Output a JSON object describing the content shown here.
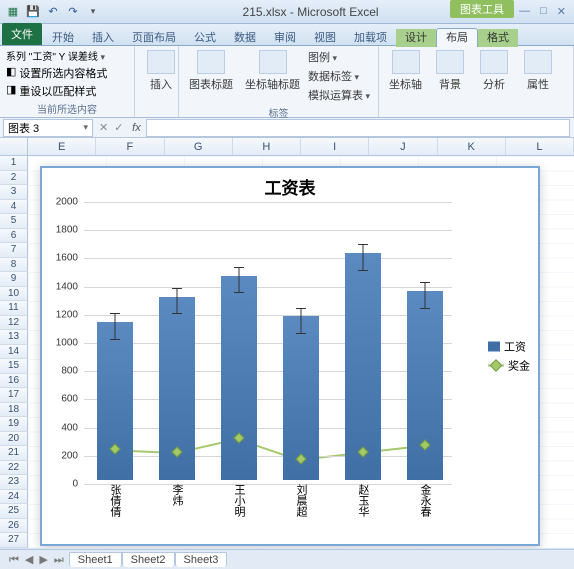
{
  "titlebar": {
    "filename": "215.xlsx - Microsoft Excel",
    "contextual": "图表工具"
  },
  "winctl": {
    "min": "—",
    "max": "□",
    "close": "✕",
    "help": "?"
  },
  "tabs": {
    "file": "文件",
    "items": [
      "开始",
      "插入",
      "页面布局",
      "公式",
      "数据",
      "审阅",
      "视图",
      "加载项",
      "设计",
      "布局",
      "格式"
    ],
    "active_index": 9
  },
  "ribbon": {
    "current_sel_group": {
      "series_line": "系列 \"工资\" Y 误差线",
      "format_sel": "设置所选内容格式",
      "reset_style": "重设以匹配样式",
      "label": "当前所选内容"
    },
    "insert": {
      "btn": "插入",
      "label": ""
    },
    "labels_group": {
      "chart_title": "图表标题",
      "axis_title": "坐标轴标题",
      "legend": "图例",
      "data_labels": "数据标签",
      "data_table": "模拟运算表",
      "label": "标签"
    },
    "axes_group": {
      "axes": "坐标轴",
      "bg": "背景",
      "analysis": "分析",
      "props": "属性"
    }
  },
  "namebox": "图表 3",
  "fx": "fx",
  "columns": [
    "E",
    "F",
    "G",
    "H",
    "I",
    "J",
    "K",
    "L"
  ],
  "rows": [
    "1",
    "2",
    "3",
    "4",
    "5",
    "6",
    "7",
    "8",
    "9",
    "10",
    "11",
    "12",
    "13",
    "14",
    "15",
    "16",
    "17",
    "18",
    "19",
    "20",
    "21",
    "22",
    "23",
    "24",
    "25",
    "26",
    "27"
  ],
  "sheets": {
    "nav": [
      "⏮",
      "◀",
      "▶",
      "⏭"
    ],
    "tabs": [
      "Sheet1",
      "Sheet2",
      "Sheet3"
    ]
  },
  "chart_data": {
    "type": "bar",
    "title": "工资表",
    "categories": [
      "张倩倩",
      "李炜",
      "王小明",
      "刘晨超",
      "赵玉华",
      "金永春"
    ],
    "series": [
      {
        "name": "工资",
        "type": "bar",
        "values": [
          1120,
          1300,
          1450,
          1160,
          1610,
          1340
        ],
        "error": 90
      },
      {
        "name": "奖金",
        "type": "line",
        "values": [
          220,
          200,
          300,
          150,
          200,
          250
        ]
      }
    ],
    "ylim": [
      0,
      2000
    ],
    "ystep": 200,
    "legend": [
      "工资",
      "奖金"
    ]
  }
}
